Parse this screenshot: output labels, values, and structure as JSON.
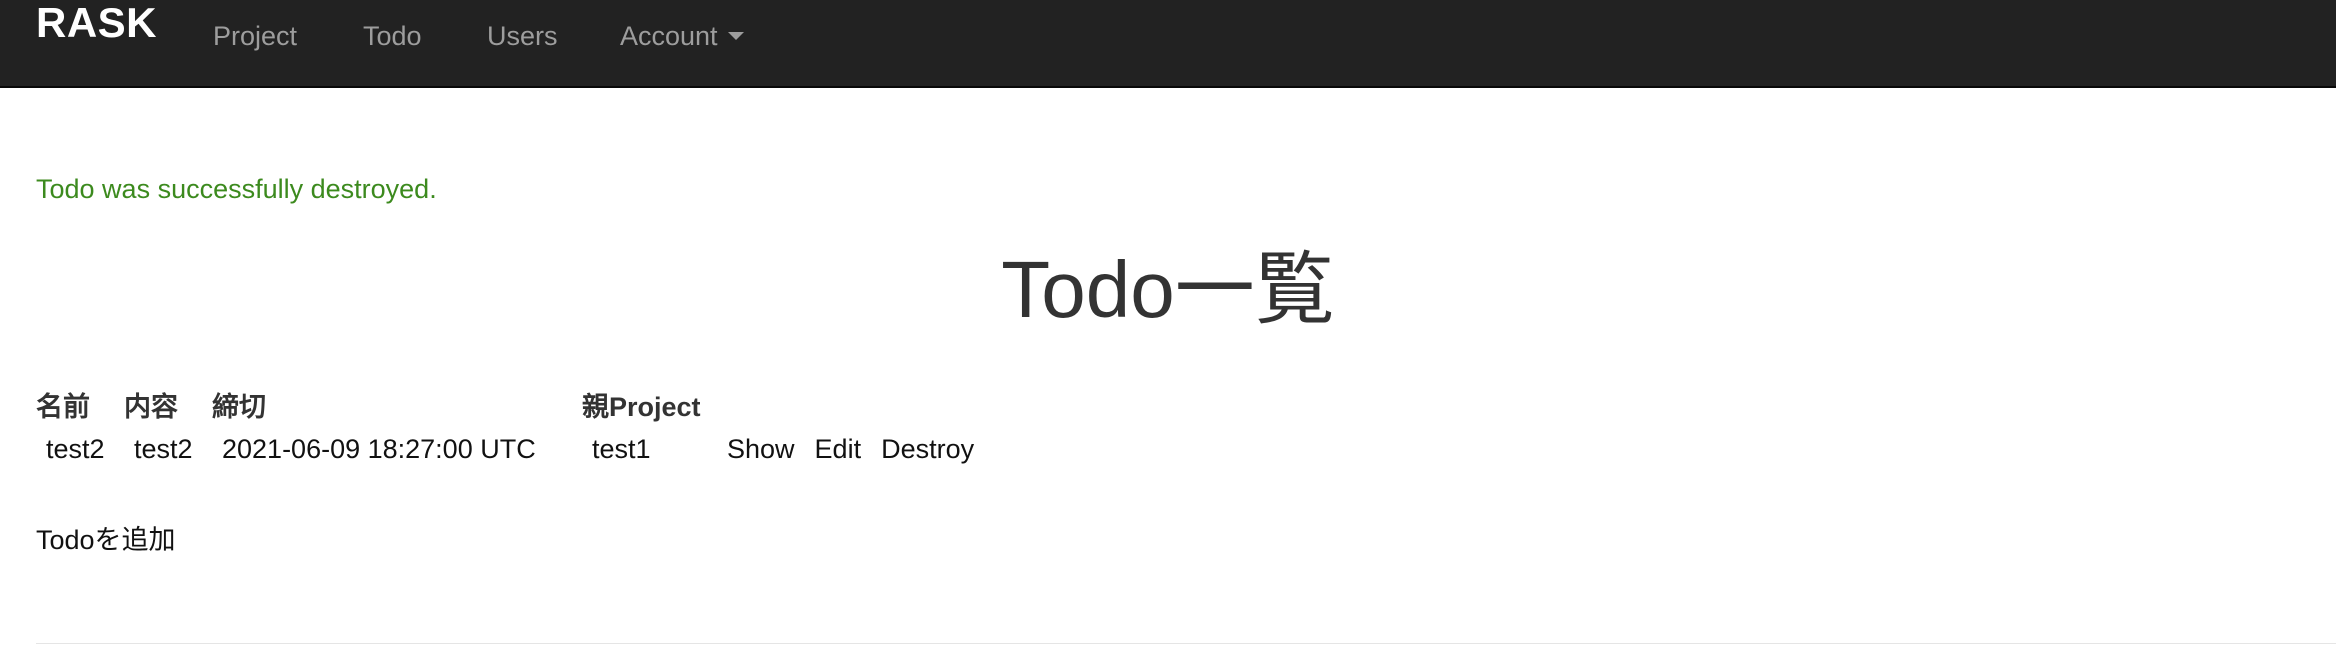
{
  "navbar": {
    "brand": "RASK",
    "items": [
      {
        "label": "Project"
      },
      {
        "label": "Todo"
      },
      {
        "label": "Users"
      },
      {
        "label": "Account",
        "has_dropdown": true
      }
    ],
    "background_color": "#222222",
    "link_color": "#9d9d9d"
  },
  "notice": {
    "text": "Todo was successfully destroyed.",
    "color": "#3c8a1e"
  },
  "page": {
    "title": "Todo一覧"
  },
  "table": {
    "headers": [
      "名前",
      "内容",
      "締切",
      "親Project"
    ],
    "rows": [
      {
        "name": "test2",
        "content": "test2",
        "deadline": "2021-06-09 18:27:00 UTC",
        "parent_project": "test1",
        "actions": {
          "show": "Show",
          "edit": "Edit",
          "destroy": "Destroy"
        }
      }
    ]
  },
  "add_link": {
    "label": "Todoを追加"
  }
}
